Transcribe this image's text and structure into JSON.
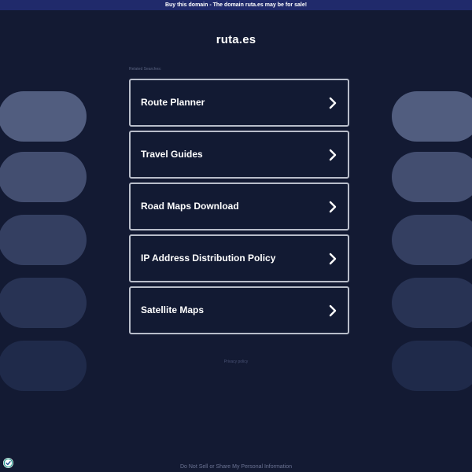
{
  "banner": {
    "text": "Buy this domain - The domain ruta.es may be for sale!"
  },
  "header": {
    "title": "ruta.es"
  },
  "related": {
    "label": "Related Searches:",
    "items": [
      {
        "label": "Route Planner"
      },
      {
        "label": "Travel Guides"
      },
      {
        "label": "Road Maps Download"
      },
      {
        "label": "IP Address Distribution Policy"
      },
      {
        "label": "Satellite Maps"
      }
    ]
  },
  "footer": {
    "privacy": "Privacy policy",
    "do_not_sell": "Do Not Sell or Share My Personal Information"
  },
  "colors": {
    "background": "#131a33",
    "banner": "#202a6b",
    "card_border": "#b8bdca",
    "pill_1": "#515d7f",
    "pill_2": "#434e70",
    "pill_3": "#343f61",
    "pill_4": "#283354",
    "pill_5": "#1f2a4a"
  },
  "icons": {
    "link_arrow": "chevron-right-icon",
    "consent": "privacy-shield-check-icon"
  }
}
